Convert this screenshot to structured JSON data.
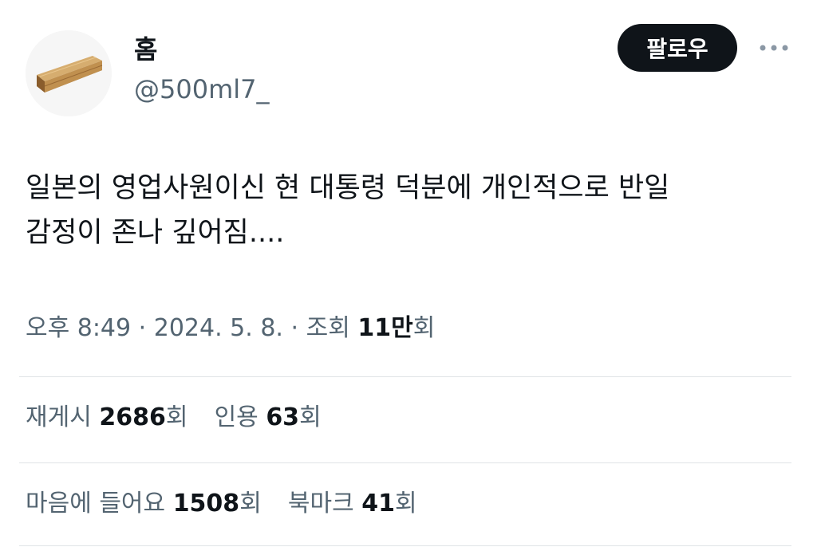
{
  "user": {
    "display_name": "홈",
    "handle": "@500ml7_",
    "avatar_icon": "coffin-icon"
  },
  "follow_label": "팔로우",
  "more_icon": "more-horizontal-icon",
  "tweet": {
    "lines": [
      "일본의 영업사원이신 현 대통령 덕분에 개인적으로 반일",
      "감정이 존나 깊어짐...."
    ]
  },
  "meta": {
    "time": "오후 8:49",
    "sep1": "·",
    "date": "2024. 5. 8.",
    "sep2": "·",
    "views_label": "조회",
    "views_count": "11만",
    "views_unit": "회"
  },
  "stats": {
    "retweets_label": "재게시",
    "retweets_count": "2686",
    "retweets_unit": "회",
    "quotes_label": "인용",
    "quotes_count": "63",
    "quotes_unit": "회",
    "likes_label": "마음에 들어요",
    "likes_count": "1508",
    "likes_unit": "회",
    "bookmarks_label": "북마크",
    "bookmarks_count": "41",
    "bookmarks_unit": "회"
  },
  "colors": {
    "text_primary": "#0f1419",
    "text_secondary": "#536471",
    "button_bg": "#0f1419",
    "divider": "#dfe3e6"
  }
}
